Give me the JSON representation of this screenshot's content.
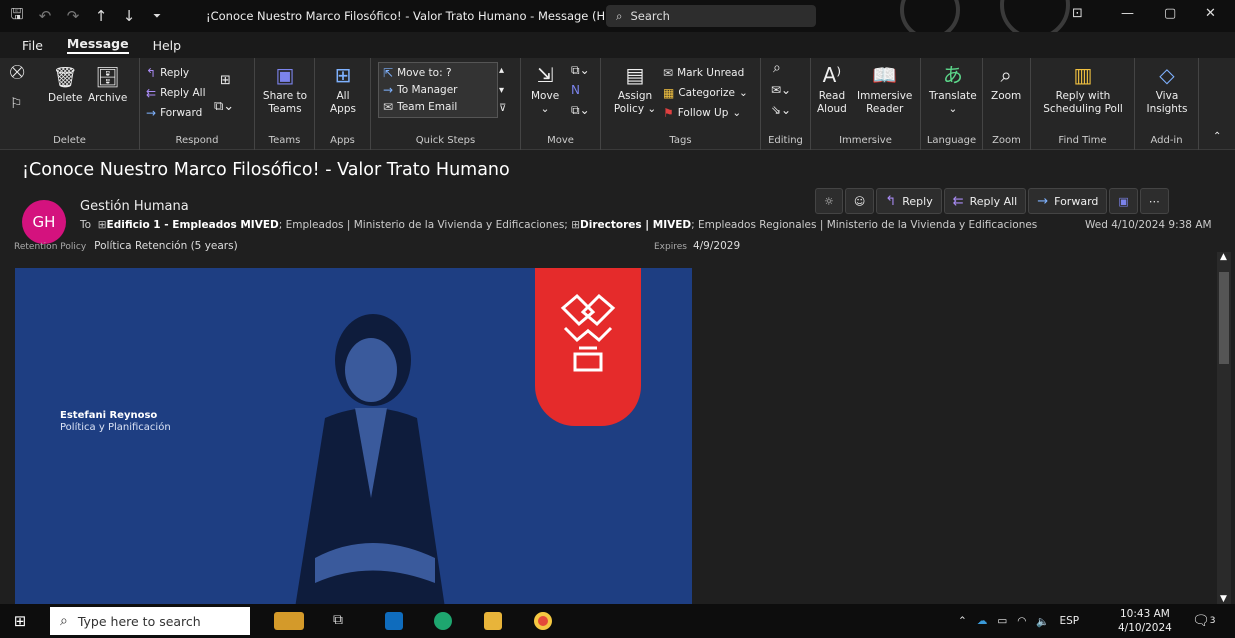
{
  "titlebar": {
    "title": "¡Conoce Nuestro Marco Filosófico! - Valor Trato Humano  -  Message (H...",
    "search_placeholder": "Search"
  },
  "menu": {
    "file": "File",
    "message": "Message",
    "help": "Help"
  },
  "ribbon": {
    "delete_label": "Delete",
    "archive_label": "Archive",
    "delete_group": "Delete",
    "reply": "Reply",
    "reply_all": "Reply All",
    "forward": "Forward",
    "respond_group": "Respond",
    "share_line1": "Share to",
    "share_line2": "Teams",
    "teams_group": "Teams",
    "all_apps_line1": "All",
    "all_apps_line2": "Apps",
    "apps_group": "Apps",
    "qs_move_to": "Move to: ?",
    "qs_to_manager": "To Manager",
    "qs_team_email": "Team Email",
    "quick_steps_group": "Quick Steps",
    "move_label": "Move",
    "move_group": "Move",
    "assign_line1": "Assign",
    "assign_line2": "Policy",
    "mark_unread": "Mark Unread",
    "categorize": "Categorize",
    "follow_up": "Follow Up",
    "tags_group": "Tags",
    "editing_group": "Editing",
    "read_line1": "Read",
    "read_line2": "Aloud",
    "immersive_line1": "Immersive",
    "immersive_line2": "Reader",
    "immersive_group": "Immersive",
    "translate": "Translate",
    "language_group": "Language",
    "zoom": "Zoom",
    "zoom_group": "Zoom",
    "reply_with_line1": "Reply with",
    "reply_with_line2": "Scheduling Poll",
    "find_time_group": "Find Time",
    "viva_line1": "Viva",
    "viva_line2": "Insights",
    "addin_group": "Add-in"
  },
  "message": {
    "subject": "¡Conoce Nuestro Marco Filosófico! - Valor Trato Humano",
    "avatar_initials": "GH",
    "sender": "Gestión Humana",
    "to_label": "To",
    "to_r1": "Edificio 1 - Empleados MIVED",
    "to_r2": "; Empleados | Ministerio de la Vivienda y Edificaciones; ",
    "to_r3": "Directores | MIVED",
    "to_r4": "; Empleados Regionales | Ministerio de la Vivienda y Edificaciones",
    "date": "Wed 4/10/2024 9:38 AM",
    "retention_label": "Retention Policy",
    "retention_value": "Política Retención (5 years)",
    "expires_label": "Expires",
    "expires_value": "4/9/2029"
  },
  "actions": {
    "reply": "Reply",
    "reply_all": "Reply All",
    "forward": "Forward"
  },
  "banner": {
    "person_name": "Estefani Reynoso",
    "person_role": "Política y Planificación",
    "bg_color": "#1e3e82",
    "accent_color": "#e52b2b"
  },
  "taskbar": {
    "search_placeholder": "Type here to search",
    "language": "ESP",
    "time": "10:43 AM",
    "date": "4/10/2024",
    "notification_count": "3"
  }
}
